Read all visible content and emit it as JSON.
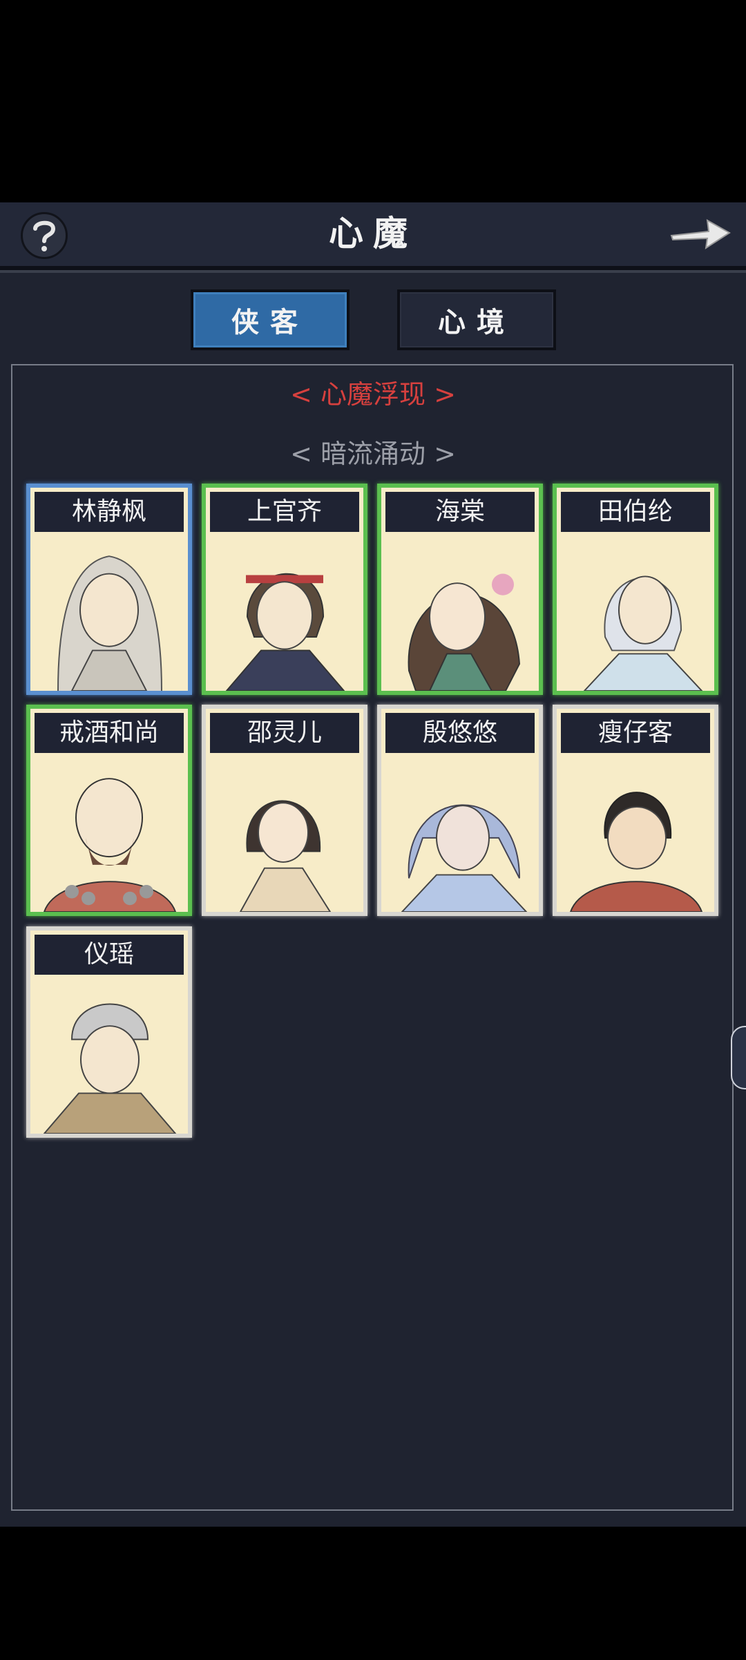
{
  "header": {
    "title": "心魔"
  },
  "tabs": [
    {
      "label": "侠客",
      "active": true
    },
    {
      "label": "心境",
      "active": false
    }
  ],
  "sections": {
    "red": "< 心魔浮现 >",
    "grey": "< 暗流涌动 >"
  },
  "characters": [
    {
      "name": "林静枫",
      "frame": "blue"
    },
    {
      "name": "上官齐",
      "frame": "green"
    },
    {
      "name": "海棠",
      "frame": "green"
    },
    {
      "name": "田伯纶",
      "frame": "green"
    },
    {
      "name": "戒酒和尚",
      "frame": "green"
    },
    {
      "name": "邵灵儿",
      "frame": "white"
    },
    {
      "name": "殷悠悠",
      "frame": "white"
    },
    {
      "name": "瘦仔客",
      "frame": "white"
    },
    {
      "name": "仪瑶",
      "frame": "white"
    }
  ],
  "colors": {
    "background": "#1f2330",
    "tab_active": "#2f6aa5",
    "frame_green": "#5bbf4f",
    "frame_blue": "#5a8fd0",
    "section_red": "#d6403e"
  }
}
